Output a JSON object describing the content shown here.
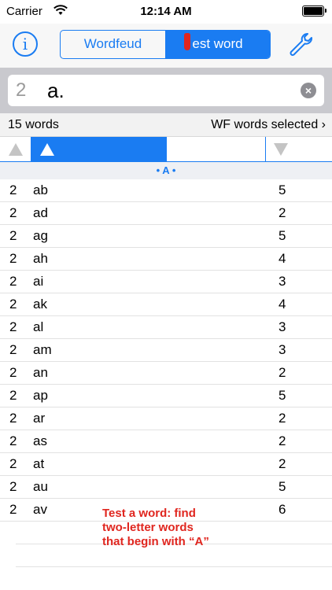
{
  "status_bar": {
    "carrier": "Carrier",
    "time": "12:14 AM"
  },
  "nav": {
    "info_glyph": "i",
    "segments": [
      {
        "label": "Wordfeud",
        "selected": false
      },
      {
        "label": "est word",
        "selected": true
      }
    ]
  },
  "search": {
    "length": "2",
    "query": "a.",
    "clear_glyph": "×"
  },
  "summary": {
    "word_count": "15 words",
    "selection": "WF words selected ›"
  },
  "section": {
    "label": "• A •"
  },
  "words": [
    {
      "length": "2",
      "word": "ab",
      "score": "5"
    },
    {
      "length": "2",
      "word": "ad",
      "score": "2"
    },
    {
      "length": "2",
      "word": "ag",
      "score": "5"
    },
    {
      "length": "2",
      "word": "ah",
      "score": "4"
    },
    {
      "length": "2",
      "word": "ai",
      "score": "3"
    },
    {
      "length": "2",
      "word": "ak",
      "score": "4"
    },
    {
      "length": "2",
      "word": "al",
      "score": "3"
    },
    {
      "length": "2",
      "word": "am",
      "score": "3"
    },
    {
      "length": "2",
      "word": "an",
      "score": "2"
    },
    {
      "length": "2",
      "word": "ap",
      "score": "5"
    },
    {
      "length": "2",
      "word": "ar",
      "score": "2"
    },
    {
      "length": "2",
      "word": "as",
      "score": "2"
    },
    {
      "length": "2",
      "word": "at",
      "score": "2"
    },
    {
      "length": "2",
      "word": "au",
      "score": "5"
    },
    {
      "length": "2",
      "word": "av",
      "score": "6"
    }
  ],
  "caption": {
    "line1": "Test a word: find",
    "line2": "two-letter words",
    "line3": "that begin with “A”"
  },
  "colors": {
    "accent": "#1a7cf2",
    "caption": "#e0261f"
  },
  "icons": {
    "info": "info-icon",
    "settings": "wrench-icon",
    "clear": "clear-icon",
    "wifi": "wifi-icon",
    "battery": "battery-icon"
  }
}
